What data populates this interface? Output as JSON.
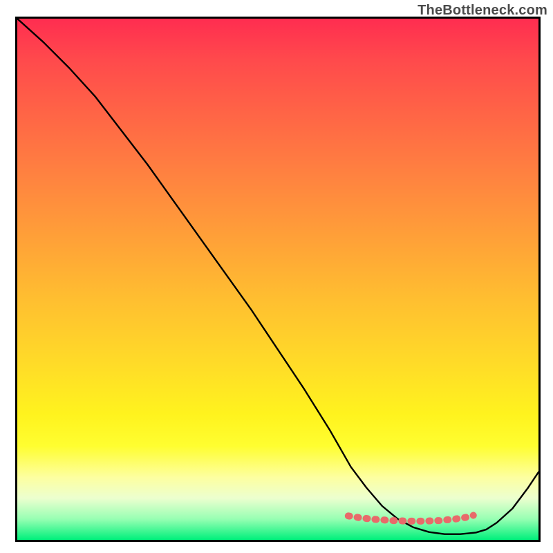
{
  "watermark": "TheBottleneck.com",
  "chart_data": {
    "type": "line",
    "title": "",
    "xlabel": "",
    "ylabel": "",
    "xlim": [
      0,
      100
    ],
    "ylim": [
      0,
      100
    ],
    "series": [
      {
        "name": "curve",
        "x": [
          0,
          5,
          10,
          15,
          20,
          25,
          30,
          35,
          40,
          45,
          50,
          55,
          60,
          62,
          64,
          67,
          70,
          73,
          76,
          79,
          82,
          85,
          88,
          90,
          92,
          95,
          98,
          100
        ],
        "y": [
          100,
          95.5,
          90.5,
          85,
          78.5,
          72,
          65,
          58,
          51,
          44,
          36.5,
          29,
          21,
          17.5,
          14,
          10,
          6.5,
          4,
          2.4,
          1.5,
          1.1,
          1.1,
          1.4,
          2,
          3.3,
          6,
          10,
          13
        ],
        "color": "#000000"
      },
      {
        "name": "highlight-band",
        "x": [
          63.5,
          66,
          69,
          72,
          75,
          78,
          81,
          84,
          86,
          87.5
        ],
        "y": [
          4.6,
          4.2,
          3.9,
          3.7,
          3.6,
          3.6,
          3.7,
          4.0,
          4.3,
          4.7
        ],
        "color": "#e86a6a"
      }
    ],
    "gradient_stops": [
      {
        "pos": 0.0,
        "color": "#ff2d50"
      },
      {
        "pos": 0.08,
        "color": "#ff4a4c"
      },
      {
        "pos": 0.18,
        "color": "#ff6446"
      },
      {
        "pos": 0.3,
        "color": "#ff8240"
      },
      {
        "pos": 0.42,
        "color": "#ffa038"
      },
      {
        "pos": 0.54,
        "color": "#ffbf30"
      },
      {
        "pos": 0.66,
        "color": "#ffdb28"
      },
      {
        "pos": 0.76,
        "color": "#fff31e"
      },
      {
        "pos": 0.82,
        "color": "#fffe30"
      },
      {
        "pos": 0.88,
        "color": "#fdffa0"
      },
      {
        "pos": 0.92,
        "color": "#ecffcf"
      },
      {
        "pos": 0.96,
        "color": "#97ffb3"
      },
      {
        "pos": 1.0,
        "color": "#00f07b"
      }
    ]
  }
}
